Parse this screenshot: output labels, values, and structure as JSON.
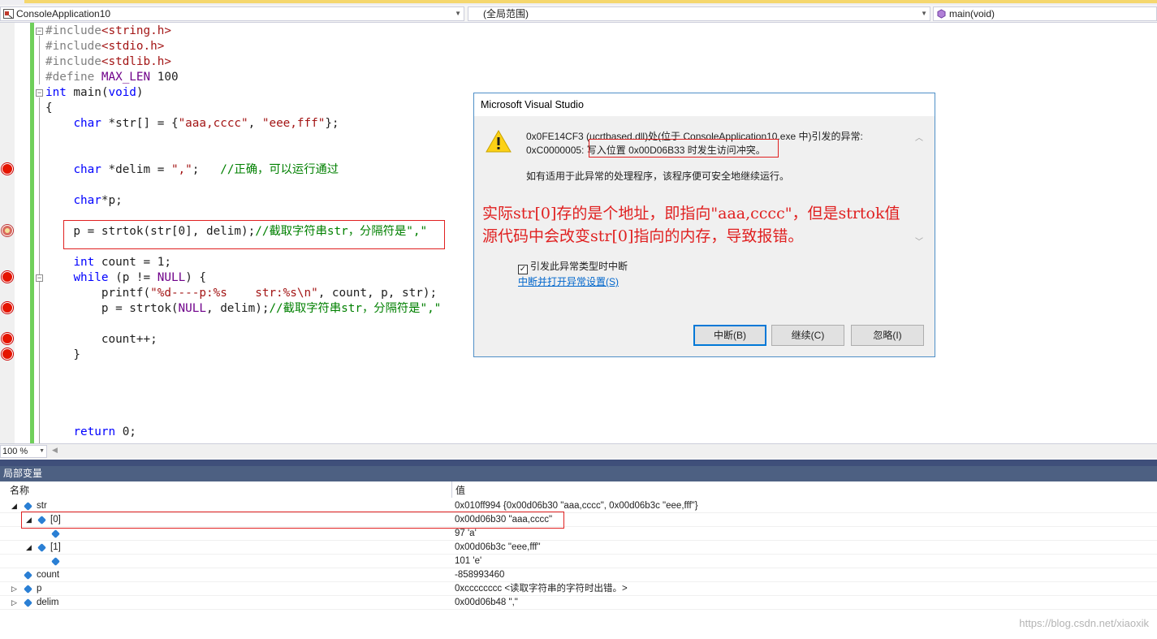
{
  "navbar": {
    "project": "ConsoleApplication10",
    "scope": "(全局范围)",
    "function": "main(void)"
  },
  "code": {
    "lines": [
      {
        "parts": [
          [
            "pp",
            "#include"
          ],
          [
            "str",
            "<string.h>"
          ]
        ]
      },
      {
        "parts": [
          [
            "pp",
            "#include"
          ],
          [
            "str",
            "<stdio.h>"
          ]
        ]
      },
      {
        "parts": [
          [
            "pp",
            "#include"
          ],
          [
            "str",
            "<stdlib.h>"
          ]
        ]
      },
      {
        "parts": [
          [
            "pp",
            "#define "
          ],
          [
            "mac",
            "MAX_LEN"
          ],
          [
            "",
            " 100"
          ]
        ]
      },
      {
        "parts": [
          [
            "kw",
            "int"
          ],
          [
            "",
            " main("
          ],
          [
            "kw",
            "void"
          ],
          [
            "",
            ")"
          ]
        ]
      },
      {
        "parts": [
          [
            "",
            "{"
          ]
        ]
      },
      {
        "parts": [
          [
            "",
            "    "
          ],
          [
            "kw",
            "char"
          ],
          [
            "",
            " *str[] = {"
          ],
          [
            "str",
            "\"aaa,cccc\""
          ],
          [
            "",
            ", "
          ],
          [
            "str",
            "\"eee,fff\""
          ],
          [
            "",
            "};"
          ]
        ]
      },
      {
        "parts": [
          [
            "",
            ""
          ]
        ]
      },
      {
        "parts": [
          [
            "",
            ""
          ]
        ]
      },
      {
        "parts": [
          [
            "",
            "    "
          ],
          [
            "kw",
            "char"
          ],
          [
            "",
            " *delim = "
          ],
          [
            "str",
            "\",\""
          ],
          [
            "",
            ";   "
          ],
          [
            "cm",
            "//正确，可以运行通过"
          ]
        ]
      },
      {
        "parts": [
          [
            "",
            ""
          ]
        ]
      },
      {
        "parts": [
          [
            "",
            "    "
          ],
          [
            "kw",
            "char"
          ],
          [
            "",
            "*p;"
          ]
        ]
      },
      {
        "parts": [
          [
            "",
            ""
          ]
        ]
      },
      {
        "parts": [
          [
            "",
            "    p = strtok(str[0], delim);"
          ],
          [
            "cm",
            "//截取字符串str，分隔符是\",\""
          ]
        ]
      },
      {
        "parts": [
          [
            "",
            ""
          ]
        ]
      },
      {
        "parts": [
          [
            "",
            "    "
          ],
          [
            "kw",
            "int"
          ],
          [
            "",
            " count = 1;"
          ]
        ]
      },
      {
        "parts": [
          [
            "",
            "    "
          ],
          [
            "kw",
            "while"
          ],
          [
            "",
            " (p != "
          ],
          [
            "mac",
            "NULL"
          ],
          [
            "",
            ") {"
          ]
        ]
      },
      {
        "parts": [
          [
            "",
            "        printf("
          ],
          [
            "str",
            "\"%d----p:%s    str:%s\\n\""
          ],
          [
            "",
            ", count, p, str);"
          ]
        ]
      },
      {
        "parts": [
          [
            "",
            "        p = strtok("
          ],
          [
            "mac",
            "NULL"
          ],
          [
            "",
            ", delim);"
          ],
          [
            "cm",
            "//截取字符串str，分隔符是\",\""
          ]
        ]
      },
      {
        "parts": [
          [
            "",
            ""
          ]
        ]
      },
      {
        "parts": [
          [
            "",
            "        count++;"
          ]
        ]
      },
      {
        "parts": [
          [
            "",
            "    }"
          ]
        ]
      },
      {
        "parts": [
          [
            "",
            ""
          ]
        ]
      },
      {
        "parts": [
          [
            "",
            ""
          ]
        ]
      },
      {
        "parts": [
          [
            "",
            ""
          ]
        ]
      },
      {
        "parts": [
          [
            "",
            ""
          ]
        ]
      },
      {
        "parts": [
          [
            "",
            "    "
          ],
          [
            "kw",
            "return"
          ],
          [
            "",
            " 0;"
          ]
        ]
      }
    ]
  },
  "dialog": {
    "title": "Microsoft Visual Studio",
    "line1": "0x0FE14CF3 (ucrtbased.dll)处(位于 ConsoleApplication10.exe 中)引发的异常:",
    "line2_prefix": "0xC0000005: ",
    "line2_error": "写入位置 0x00D06B33 时发生访问冲突。",
    "line3": "如有适用于此异常的处理程序，该程序便可安全地继续运行。",
    "checkbox_label": "引发此异常类型时中断",
    "link": "中断并打开异常设置(S)",
    "buttons": {
      "break": "中断(B)",
      "continue": "继续(C)",
      "ignore": "忽略(I)"
    }
  },
  "annotation": {
    "line1": "实际str[0]存的是个地址，即指向\"aaa,cccc\"，但是strtok值",
    "line2": "源代码中会改变str[0]指向的内存，导致报错。"
  },
  "statusbar": {
    "zoom": "100 %"
  },
  "locals": {
    "title": "局部变量",
    "col_name": "名称",
    "col_value": "值",
    "rows": [
      {
        "name": "str",
        "value": "0x010ff994 {0x00d06b30 \"aaa,cccc\", 0x00d06b3c \"eee,fff\"}"
      },
      {
        "name": "[0]",
        "value": "0x00d06b30 \"aaa,cccc\""
      },
      {
        "name": "",
        "value": "97 'a'"
      },
      {
        "name": "[1]",
        "value": "0x00d06b3c \"eee,fff\""
      },
      {
        "name": "",
        "value": "101 'e'"
      },
      {
        "name": "count",
        "value": "-858993460"
      },
      {
        "name": "p",
        "value": "0xcccccccc <读取字符串的字符时出错。>"
      },
      {
        "name": "delim",
        "value": "0x00d06b48 \",\""
      }
    ]
  },
  "watermark": "https://blog.csdn.net/xiaoxik"
}
